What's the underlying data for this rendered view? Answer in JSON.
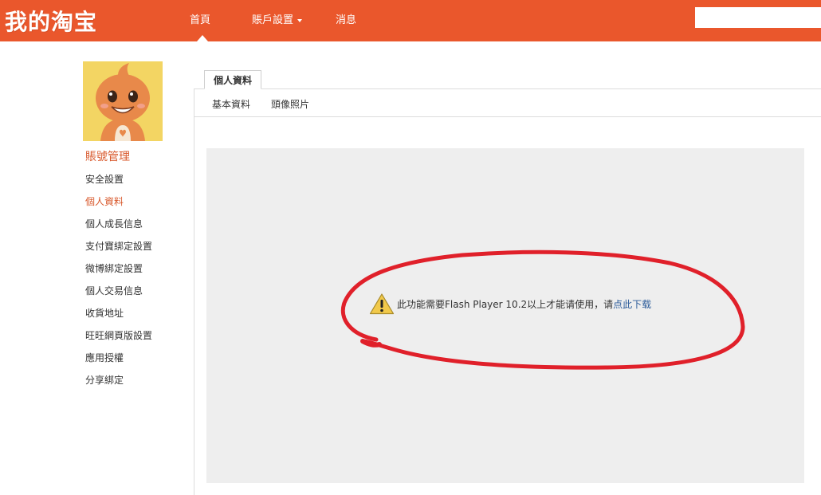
{
  "header": {
    "logo": "我的淘宝",
    "nav": {
      "home": "首頁",
      "account_settings": "賬戶設置",
      "messages": "消息"
    },
    "search": {
      "value": "",
      "placeholder": ""
    }
  },
  "sidebar": {
    "title": "賬號管理",
    "items": [
      {
        "label": "安全設置",
        "active": false
      },
      {
        "label": "個人資料",
        "active": true
      },
      {
        "label": "個人成長信息",
        "active": false
      },
      {
        "label": "支付寶綁定設置",
        "active": false
      },
      {
        "label": "微博綁定設置",
        "active": false
      },
      {
        "label": "個人交易信息",
        "active": false
      },
      {
        "label": "收貨地址",
        "active": false
      },
      {
        "label": "旺旺網頁版設置",
        "active": false
      },
      {
        "label": "應用授權",
        "active": false
      },
      {
        "label": "分享綁定",
        "active": false
      }
    ]
  },
  "main": {
    "tab": "個人資料",
    "subtabs": {
      "basic": "基本資料",
      "photo": "頭像照片"
    },
    "flash_notice": {
      "text": "此功能需要Flash Player 10.2以上才能请使用，请",
      "link": "点此下载"
    }
  },
  "colors": {
    "brand": "#ea572c",
    "active_text": "#d8582b",
    "link": "#2c5c9a",
    "annotation": "#e0202a",
    "flash_bg": "#eeeeee"
  },
  "icons": {
    "warning": "warning-icon",
    "dropdown": "chevron-down-icon",
    "pointer": "nav-pointer-icon"
  }
}
